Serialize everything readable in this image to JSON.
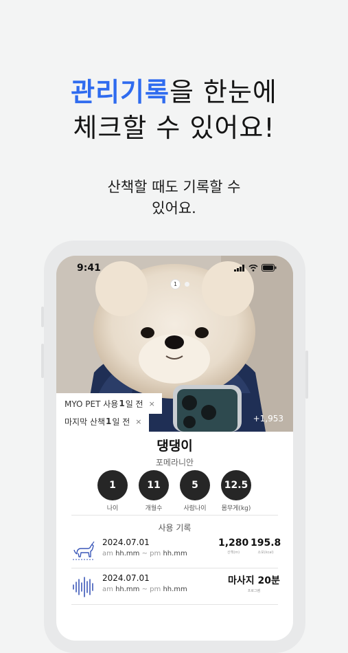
{
  "headline": {
    "accent": "관리기록",
    "line1_rest": "을 한눈에",
    "line2": "체크할 수 있어요!"
  },
  "subtitle": {
    "line1": "산책할 때도 기록할 수",
    "line2": "있어요."
  },
  "phone": {
    "status_time": "9:41",
    "page_indicator": "1",
    "photo_views": "+1,953",
    "tags": [
      {
        "prefix": "MYO PET 사용 ",
        "number": "1",
        "suffix": "일 전",
        "close": "×"
      },
      {
        "prefix": "마지막 산책 ",
        "number": "1",
        "suffix": "일 전",
        "close": "×"
      }
    ],
    "pet_name": "댕댕이",
    "breed": "포메라니안",
    "stats": [
      {
        "value": "1",
        "label": "나이"
      },
      {
        "value": "11",
        "label": "개월수"
      },
      {
        "value": "5",
        "label": "사람나이"
      },
      {
        "value": "12.5",
        "label": "몸무게(kg)"
      }
    ],
    "records_title": "사용 기록",
    "records": [
      {
        "icon": "dog-walk-icon",
        "date": "2024.07.01",
        "am": "am",
        "start": "hh.mm",
        "sep": "~ pm",
        "end": "hh.mm",
        "metrics": [
          {
            "value": "1,280",
            "unit": "산책(m)"
          },
          {
            "value": "195.8",
            "unit": "소모(kcal)"
          }
        ]
      },
      {
        "icon": "sound-wave-icon",
        "date": "2024.07.01",
        "am": "am",
        "start": "hh.mm",
        "sep": "~ pm",
        "end": "hh.mm",
        "metrics": [
          {
            "value": "마사지 20분",
            "unit": "프로그램"
          }
        ]
      }
    ]
  },
  "colors": {
    "accent": "#2f6bef",
    "background": "#f3f4f4",
    "stat_circle": "#262626"
  }
}
